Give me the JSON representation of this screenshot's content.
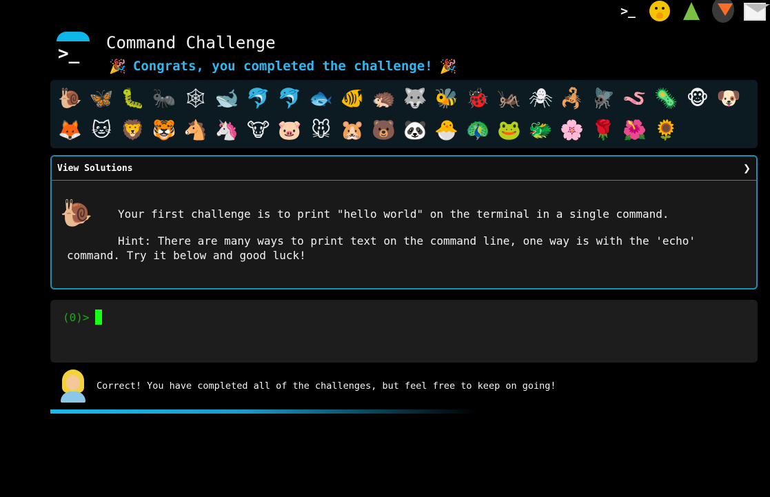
{
  "topbar": {
    "icons": [
      "terminal-icon",
      "face-with-hand-over-mouth-icon",
      "evergreen-tree-icon",
      "gitlab-icon",
      "envelope-icon"
    ],
    "terminal_glyph": ">_"
  },
  "header": {
    "logo_glyph": ">_",
    "title": "Command Challenge",
    "subtitle": "Congrats, you completed the challenge!",
    "party_emoji": "🎉",
    "accent_color": "#31b6ef"
  },
  "animals": [
    "🐌",
    "🦋",
    "🐛",
    "🐜",
    "🕸",
    "🐋",
    "🐬",
    "🐬",
    "🐟",
    "🐠",
    "🦔",
    "🐺",
    "🐝",
    "🐞",
    "🦗",
    "🕷",
    "🦂",
    "🪰",
    "🪱",
    "🦠",
    "🐵",
    "🐶",
    "🦊",
    "🐱",
    "🦁",
    "🐯",
    "🐴",
    "🦄",
    "🐮",
    "🐷",
    "🐭",
    "🐹",
    "🐻",
    "🐼",
    "🐣",
    "🦚",
    "🐸",
    "🐲",
    "🌸",
    "🌹",
    "🌺",
    "🌻"
  ],
  "panel": {
    "header_label": "View Solutions",
    "chevron": "❯",
    "icon": "🐌",
    "task": "Your first challenge is to print \"hello world\" on the terminal in a single command.",
    "hint": "Hint: There are many ways to print text on the command line, one way is with the 'echo' command. Try it below and good luck!"
  },
  "terminal": {
    "prompt": "(0)>",
    "value": ""
  },
  "result": {
    "message": "Correct! You have completed all of the challenges, but feel free to keep on going!"
  },
  "progress": {
    "fraction": 1.0
  }
}
